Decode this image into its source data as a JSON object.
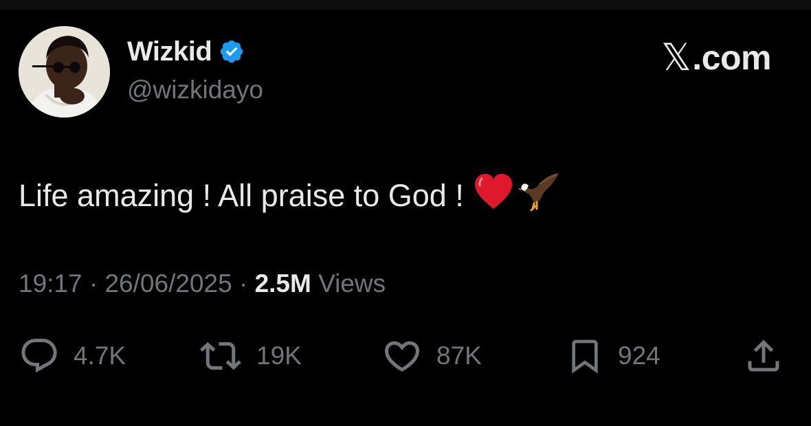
{
  "header": {
    "display_name": "Wizkid",
    "handle": "@wizkidayo",
    "verified_icon": "verified-badge-icon",
    "brand": ".com",
    "brand_glyph": "𝕏"
  },
  "tweet": {
    "text": "Life amazing ! All praise to God !",
    "emoji": [
      "red-heart",
      "eagle"
    ]
  },
  "meta": {
    "time": "19:17",
    "separator": "·",
    "date": "26/06/2025",
    "views_count": "2.5M",
    "views_label": "Views"
  },
  "actions": {
    "reply": {
      "icon": "reply-icon",
      "count": "4.7K"
    },
    "repost": {
      "icon": "repost-icon",
      "count": "19K"
    },
    "like": {
      "icon": "heart-icon",
      "count": "87K"
    },
    "bookmark": {
      "icon": "bookmark-icon",
      "count": "924"
    },
    "share": {
      "icon": "share-icon"
    }
  },
  "colors": {
    "background": "#000000",
    "primary_text": "#e7e9ea",
    "secondary_text": "#71767b",
    "verified_blue": "#1d9bf0",
    "heart_red": "#e0245e"
  }
}
